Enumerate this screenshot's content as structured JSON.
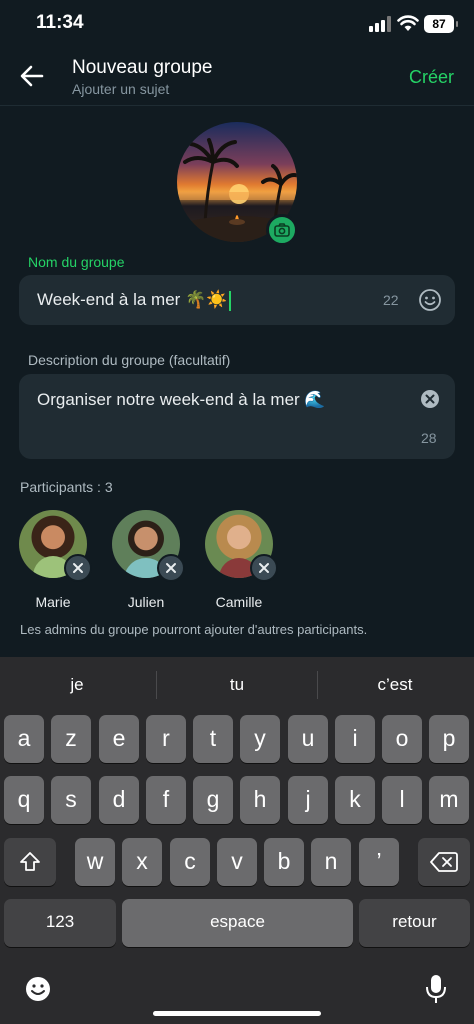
{
  "status": {
    "time": "11:34",
    "battery": "87"
  },
  "header": {
    "title": "Nouveau groupe",
    "subtitle": "Ajouter un sujet",
    "create": "Créer"
  },
  "name_field": {
    "label": "Nom du groupe",
    "value": "Week-end à la mer 🌴☀️",
    "count": "22"
  },
  "desc_field": {
    "label": "Description du groupe (facultatif)",
    "value": "Organiser notre week-end à la mer 🌊",
    "count": "28"
  },
  "participants": {
    "title": "Participants : 3",
    "people": [
      {
        "name": "Marie"
      },
      {
        "name": "Julien"
      },
      {
        "name": "Camille"
      }
    ],
    "hint": "Les admins du groupe pourront ajouter d'autres participants."
  },
  "keyboard": {
    "suggestions": [
      "je",
      "tu",
      "c’est"
    ],
    "row1": [
      "a",
      "z",
      "e",
      "r",
      "t",
      "y",
      "u",
      "i",
      "o",
      "p"
    ],
    "row2": [
      "q",
      "s",
      "d",
      "f",
      "g",
      "h",
      "j",
      "k",
      "l",
      "m"
    ],
    "row3": [
      "w",
      "x",
      "c",
      "v",
      "b",
      "n",
      "’"
    ],
    "numbers": "123",
    "space": "espace",
    "return": "retour"
  }
}
